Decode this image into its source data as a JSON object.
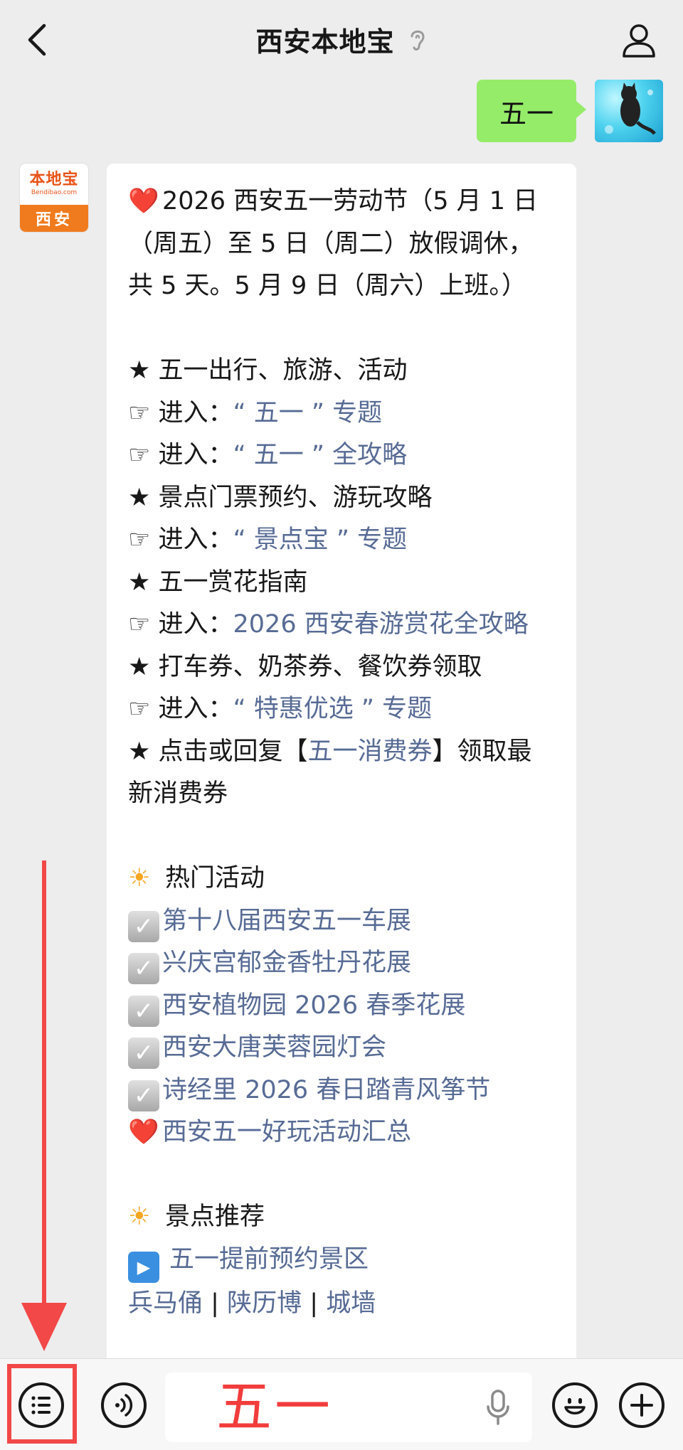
{
  "header": {
    "title": "西安本地宝"
  },
  "user_message": {
    "text": "五一"
  },
  "bot": {
    "avatar": {
      "logo_text": "本地宝",
      "logo_url": "Bendibao.com",
      "city": "西安"
    },
    "intro": {
      "heart": "❤️",
      "text": "2026 西安五一劳动节（5 月 1 日（周五）至 5 日（周二）放假调休，共 5 天。5 月 9 日（周六）上班。）"
    },
    "section1": {
      "heading": "★ 五一出行、旅游、活动",
      "links": [
        {
          "prefix": "☞ 进入：",
          "label": "“ 五一 ” 专题"
        },
        {
          "prefix": "☞ 进入：",
          "label": "“ 五一 ” 全攻略"
        }
      ]
    },
    "section2": {
      "heading": "★ 景点门票预约、游玩攻略",
      "links": [
        {
          "prefix": "☞ 进入：",
          "label": "“ 景点宝 ” 专题"
        }
      ]
    },
    "section3": {
      "heading": "★ 五一赏花指南",
      "link": {
        "prefix": "☞ 进入：",
        "label": "2026 西安春游赏花全攻略"
      }
    },
    "section4": {
      "heading": "★ 打车券、奶茶券、餐饮券领取",
      "link": {
        "prefix": "☞ 进入：",
        "label": "“ 特惠优选 ” 专题"
      }
    },
    "section5": {
      "prefix": "★ 点击或回复【",
      "link": "五一消费券",
      "suffix": "】领取最新消费券"
    },
    "hot": {
      "sun": "☀",
      "heading": "热门活动",
      "items": [
        "第十八届西安五一车展",
        "兴庆宫郁金香牡丹花展",
        "西安植物园 2026 春季花展",
        "西安大唐芙蓉园灯会",
        "诗经里 2026 春日踏青风筝节"
      ],
      "heart_item": "西安五一好玩活动汇总"
    },
    "spots": {
      "sun": "☀",
      "heading": "景点推荐",
      "play_item": "五一提前预约景区",
      "links": [
        "兵马俑",
        "陕历博",
        "城墙"
      ],
      "separator": "|"
    }
  },
  "input": {
    "value": "五一"
  },
  "colors": {
    "link": "#576b95",
    "my_bubble": "#95ec69",
    "annotation": "#f24848",
    "background": "#ededed"
  }
}
